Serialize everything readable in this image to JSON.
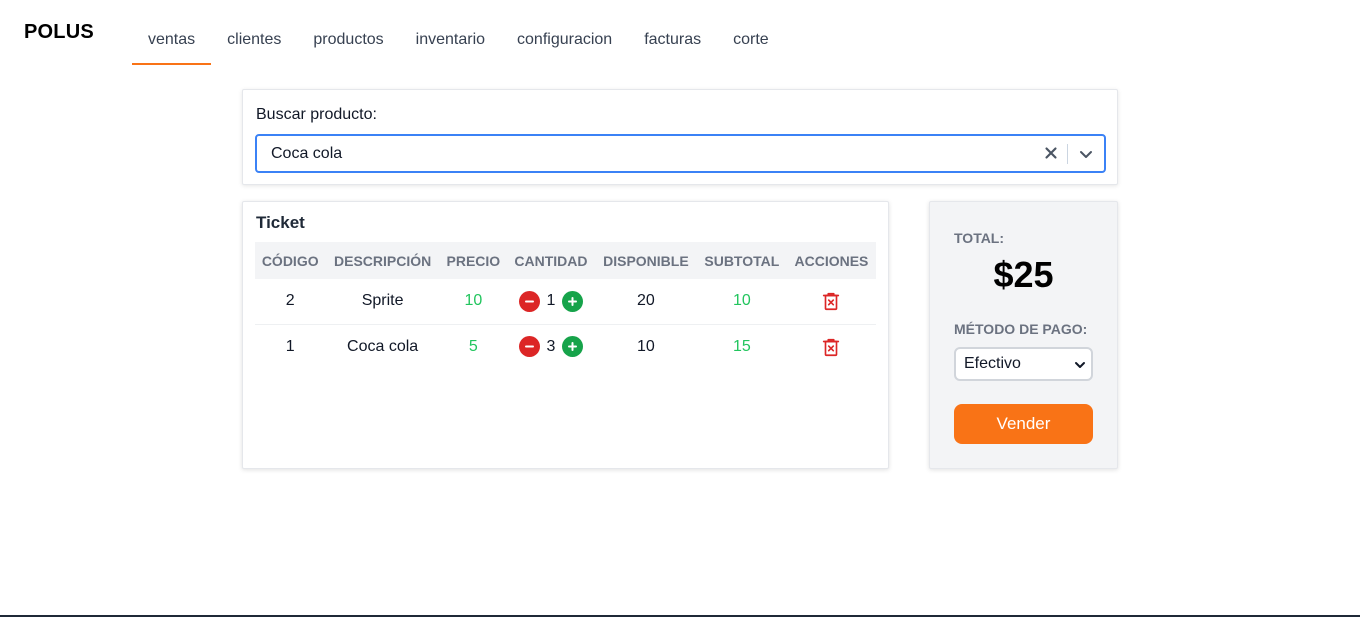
{
  "app": {
    "logo": "POLUS"
  },
  "nav": {
    "items": [
      {
        "label": "ventas",
        "active": true
      },
      {
        "label": "clientes"
      },
      {
        "label": "productos"
      },
      {
        "label": "inventario"
      },
      {
        "label": "configuracion"
      },
      {
        "label": "facturas"
      },
      {
        "label": "corte"
      }
    ]
  },
  "search": {
    "label": "Buscar producto:",
    "value": "Coca cola",
    "clear_icon": "close-icon",
    "dropdown_icon": "chevron-down-icon"
  },
  "ticket": {
    "title": "Ticket",
    "columns": [
      "CÓDIGO",
      "DESCRIPCIÓN",
      "PRECIO",
      "CANTIDAD",
      "DISPONIBLE",
      "SUBTOTAL",
      "ACCIONES"
    ],
    "rows": [
      {
        "codigo": "2",
        "descripcion": "Sprite",
        "precio": "10",
        "cantidad": "1",
        "disponible": "20",
        "subtotal": "10"
      },
      {
        "codigo": "1",
        "descripcion": "Coca cola",
        "precio": "5",
        "cantidad": "3",
        "disponible": "10",
        "subtotal": "15"
      }
    ],
    "action_icons": {
      "decrease": "minus-icon",
      "increase": "plus-icon",
      "delete": "trash-icon"
    }
  },
  "summary": {
    "total_label": "TOTAL:",
    "total_value": "$25",
    "payment_label": "MÉTODO DE PAGO:",
    "payment_method": "Efectivo",
    "sell_button": "Vender"
  },
  "colors": {
    "accent": "#f97316",
    "focus": "#3b82f6",
    "positive": "#22c55e",
    "danger": "#dc2626",
    "increase": "#16a34a"
  }
}
